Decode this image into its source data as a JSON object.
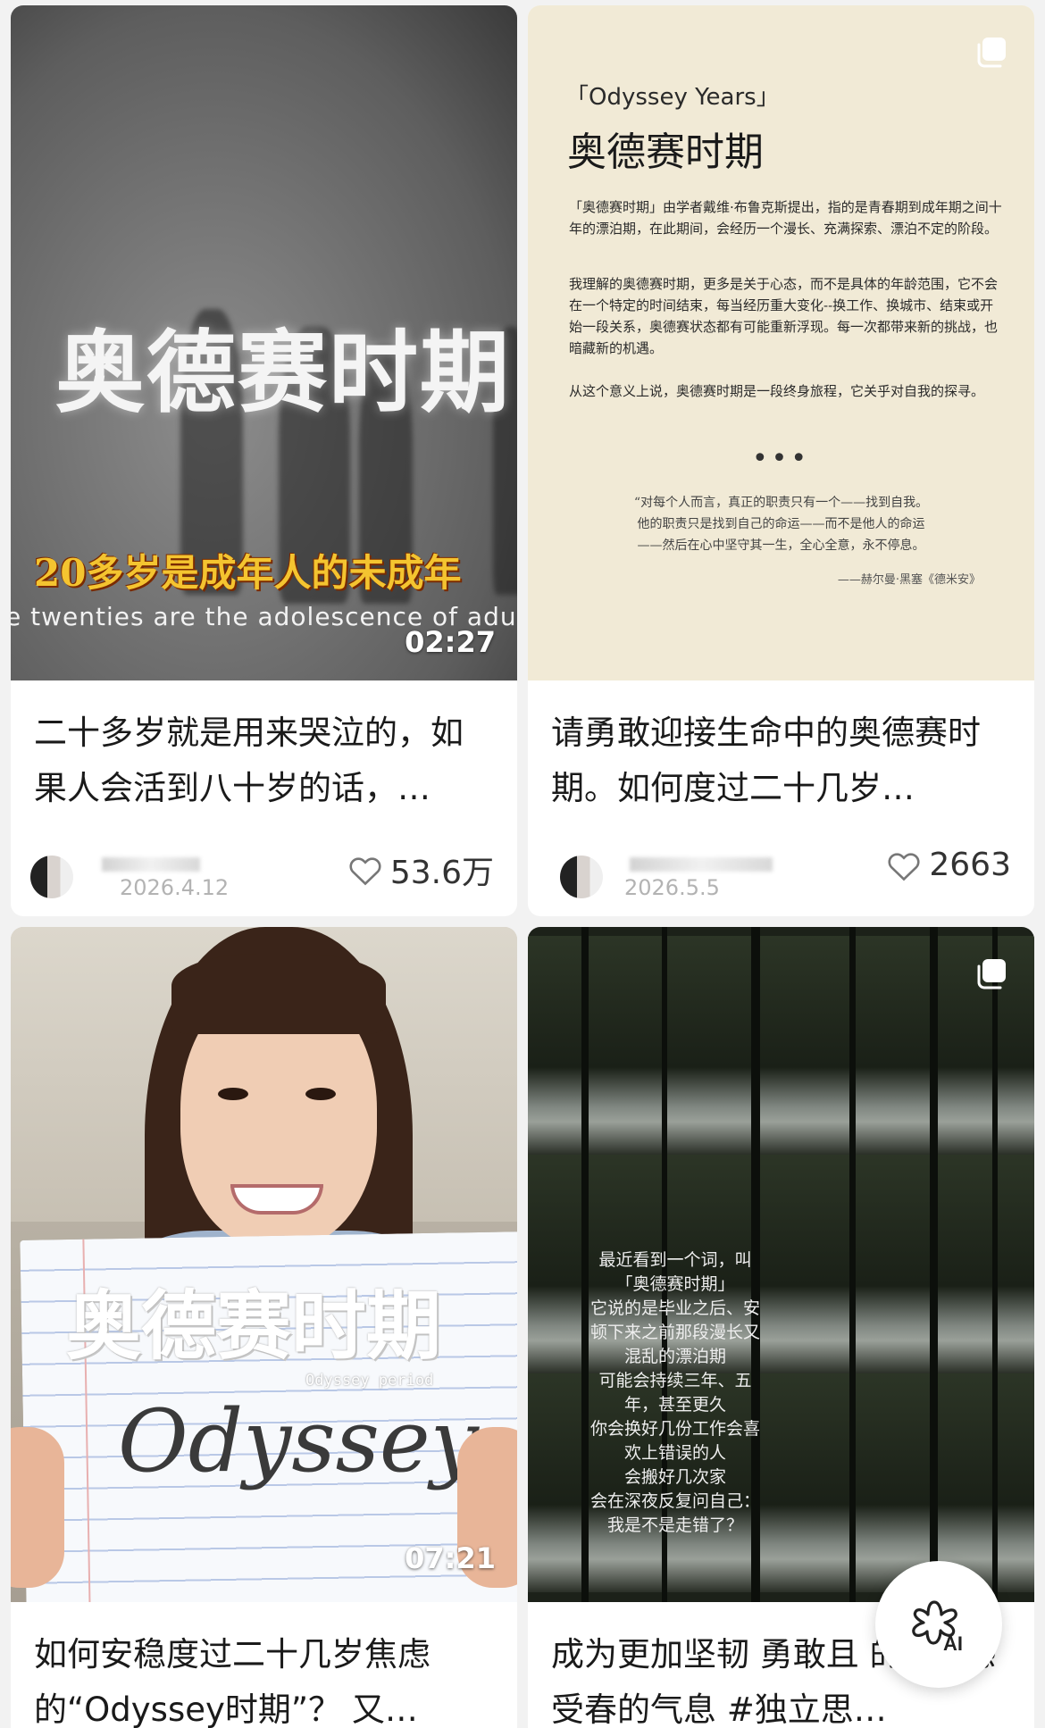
{
  "cards": [
    {
      "cover": {
        "title_text": "奥德赛时期",
        "subtitle_cn": "20多岁是成年人的未成年",
        "subtitle_en": "e twenties are the adolescence of adultho",
        "duration": "02:27"
      },
      "title": "二十多岁就是用来哭泣的，如果人会活到八十岁的话，…",
      "date": "2026.4.12",
      "likes": "53.6万",
      "icons": {
        "like": "heart-outline-icon"
      }
    },
    {
      "cover": {
        "en_title": "「Odyssey Years」",
        "zh_title": "奥德赛时期",
        "para1": "「奥德赛时期」由学者戴维·布鲁克斯提出，指的是青春期到成年期之间十年的漂泊期，在此期间，会经历一个漫长、充满探索、漂泊不定的阶段。",
        "para2": "我理解的奥德赛时期，更多是关于心态，而不是具体的年龄范围，它不会在一个特定的时间结束，每当经历重大变化--换工作、换城市、结束或开始一段关系，奥德赛状态都有可能重新浮现。每一次都带来新的挑战，也暗藏新的机遇。",
        "para3": "从这个意义上说，奥德赛时期是一段终身旅程，它关乎对自我的探寻。",
        "dots": "•••",
        "quote1": "“对每个人而言，真正的职责只有一个——找到自我。",
        "quote2": "他的职责只是找到自己的命运——而不是他人的命运",
        "quote3": "——然后在心中坚守其一生，全心全意，永不停息。",
        "signature": "——赫尔曼·黑塞《德米安》"
      },
      "title": "请勇敢迎接生命中的奥德赛时期。如何度过二十几岁…",
      "date": "2026.5.5",
      "likes": "2663",
      "icons": {
        "like": "heart-outline-icon",
        "multi": "multi-image-icon"
      }
    },
    {
      "cover": {
        "paper_title": "奥德赛时期",
        "paper_subtitle": "Odyssey period",
        "script": "Odyssey.",
        "duration": "07:21"
      },
      "title": "如何安稳度过二十几岁焦虑的“Odyssey时期”？ 又…"
    },
    {
      "cover": {
        "poem": [
          "最近看到一个词，叫",
          "「奥德赛时期」",
          "它说的是毕业之后、安",
          "顿下来之前那段漫长又",
          "混乱的漂泊期",
          "可能会持续三年、五",
          "年，甚至更久",
          "你会换好几份工作会喜",
          "欢上错误的人",
          "会搬好几次家",
          "会在深夜反复问自己：",
          "我是不是走错了？"
        ]
      },
      "title": "成为更加坚韧 勇敢且 的人#感受春的气息 #独立思…",
      "icons": {
        "multi": "multi-image-icon"
      }
    }
  ],
  "ai_button": {
    "label": "AI",
    "icon": "ai-sparkle-icon"
  },
  "colors": {
    "background": "#f2f2f2",
    "card": "#ffffff",
    "text": "#1a1a1a",
    "muted": "#b3b3b3"
  }
}
